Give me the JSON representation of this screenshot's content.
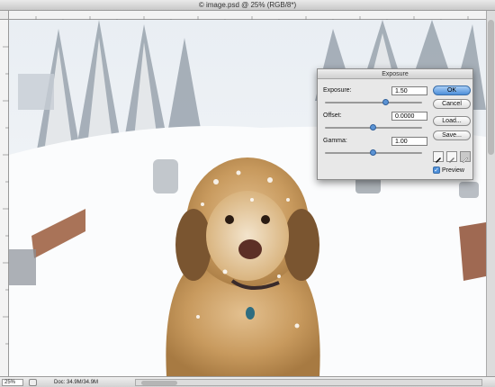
{
  "window": {
    "title": "© image.psd @ 25% (RGB/8*)"
  },
  "status": {
    "zoom": "25%",
    "doc": "Doc: 34.9M/34.9M"
  },
  "dialog": {
    "title": "Exposure",
    "exposure": {
      "label": "Exposure:",
      "value": "1.50",
      "slider": 0.63
    },
    "offset": {
      "label": "Offset:",
      "value": "0.0000",
      "slider": 0.5
    },
    "gamma": {
      "label": "Gamma:",
      "value": "1.00",
      "slider": 0.5
    },
    "buttons": {
      "ok": "OK",
      "cancel": "Cancel",
      "load": "Load...",
      "save": "Save..."
    },
    "preview": {
      "label": "Preview",
      "checked": true
    }
  },
  "colors": {
    "accent": "#4d8fd9",
    "dog_fur": "#c99a5e",
    "snow": "#f5f7fa"
  }
}
